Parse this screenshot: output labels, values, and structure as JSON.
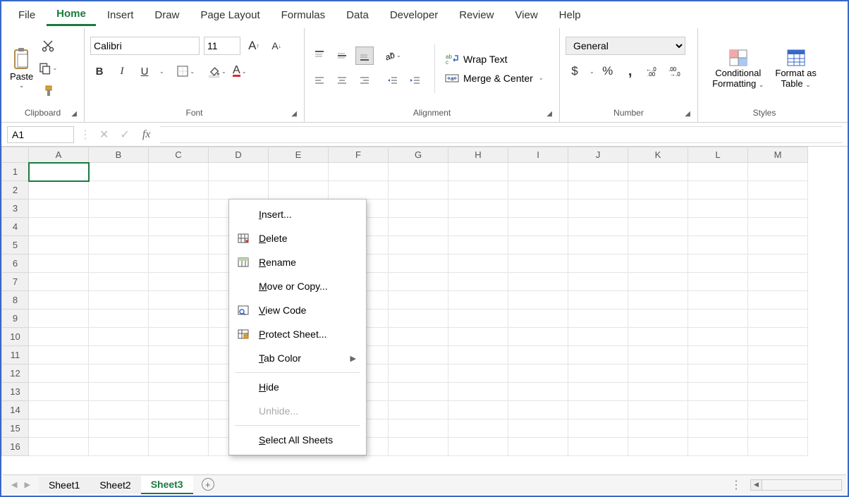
{
  "menu": {
    "file": "File",
    "home": "Home",
    "insert": "Insert",
    "draw": "Draw",
    "page_layout": "Page Layout",
    "formulas": "Formulas",
    "data": "Data",
    "developer": "Developer",
    "review": "Review",
    "view": "View",
    "help": "Help"
  },
  "ribbon": {
    "clipboard": {
      "paste": "Paste",
      "label": "Clipboard"
    },
    "font": {
      "name": "Calibri",
      "size": "11",
      "bold": "B",
      "italic": "I",
      "underline": "U",
      "label": "Font"
    },
    "alignment": {
      "wrap": "Wrap Text",
      "merge": "Merge & Center",
      "label": "Alignment"
    },
    "number": {
      "format": "General",
      "currency": "$",
      "percent": "%",
      "comma": ",",
      "inc_dec": "←.0",
      "dec_dec": ".00",
      "label": "Number"
    },
    "styles": {
      "cond": "Conditional",
      "cond2": "Formatting",
      "fat": "Format as",
      "fat2": "Table",
      "label": "Styles"
    }
  },
  "name_box": "A1",
  "fx": "fx",
  "columns": [
    "A",
    "B",
    "C",
    "D",
    "E",
    "F",
    "G",
    "H",
    "I",
    "J",
    "K",
    "L",
    "M"
  ],
  "rows": [
    "1",
    "2",
    "3",
    "4",
    "5",
    "6",
    "7",
    "8",
    "9",
    "10",
    "11",
    "12",
    "13",
    "14",
    "15",
    "16"
  ],
  "tabs": {
    "sheet1": "Sheet1",
    "sheet2": "Sheet2",
    "sheet3": "Sheet3"
  },
  "context_menu": {
    "insert": "nsert...",
    "delete": "elete",
    "rename": "ename",
    "move": "ove or Copy...",
    "view_code": "iew Code",
    "protect": "rotect Sheet...",
    "tab_color": "ab Color",
    "hide": "ide",
    "unhide": "Unhide...",
    "select_all": "elect All Sheets"
  },
  "ctx_access": {
    "insert": "I",
    "delete": "D",
    "rename": "R",
    "move": "M",
    "view_code": "V",
    "protect": "P",
    "tab_color": "T",
    "hide": "H",
    "select_all": "S"
  }
}
